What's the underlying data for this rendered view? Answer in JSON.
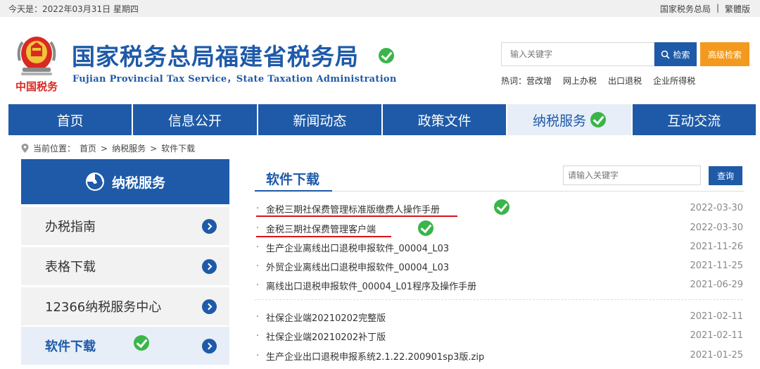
{
  "topbar": {
    "date": "今天是：2022年03月31日 星期四",
    "link_main": "国家税务总局",
    "separator": "|",
    "link_trad": "繁體版"
  },
  "header": {
    "title": "国家税务总局福建省税务局",
    "subtitle": "Fujian Provincial Tax Service，State Taxation Administration",
    "emblem_caption": "中国税务"
  },
  "search": {
    "placeholder": "输入关键字",
    "button": "检索",
    "advanced": "高级检索",
    "hot_label": "热词：",
    "hot_words": [
      "营改增",
      "网上办税",
      "出口退税",
      "企业所得税"
    ]
  },
  "nav": {
    "items": [
      "首页",
      "信息公开",
      "新闻动态",
      "政策文件",
      "纳税服务",
      "互动交流"
    ],
    "active_index": 4
  },
  "breadcrumb": {
    "label": "当前位置：",
    "items": [
      "首页",
      "纳税服务",
      "软件下载"
    ],
    "sep": ">"
  },
  "sidebar": {
    "heading": "纳税服务",
    "items": [
      "办税指南",
      "表格下载",
      "12366纳税服务中心",
      "软件下载"
    ],
    "active_index": 3
  },
  "main": {
    "section_title": "软件下载",
    "keyword_placeholder": "请输入关键字",
    "query_button": "查询",
    "bullet": "·",
    "rows": [
      {
        "title": "金税三期社保费管理标准版缴费人操作手册",
        "date": "2022-03-30"
      },
      {
        "title": "金税三期社保费管理客户端",
        "date": "2022-03-30"
      },
      {
        "title": "生产企业离线出口退税申报软件_00004_L03",
        "date": "2021-11-26"
      },
      {
        "title": "外贸企业离线出口退税申报软件_00004_L03",
        "date": "2021-11-25"
      },
      {
        "title": "离线出口退税申报软件_00004_L01程序及操作手册",
        "date": "2021-06-29"
      },
      {
        "title": "社保企业端20210202完整版",
        "date": "2021-02-11"
      },
      {
        "title": "社保企业端20210202补丁版",
        "date": "2021-02-11"
      },
      {
        "title": "生产企业出口退税申报系统2.1.22.200901sp3版.zip",
        "date": "2021-01-25"
      }
    ]
  },
  "colors": {
    "brand_blue": "#1e5aa8",
    "accent_orange": "#f39a1e",
    "check_green": "#3ab54a",
    "underline_red": "#d9141c"
  }
}
